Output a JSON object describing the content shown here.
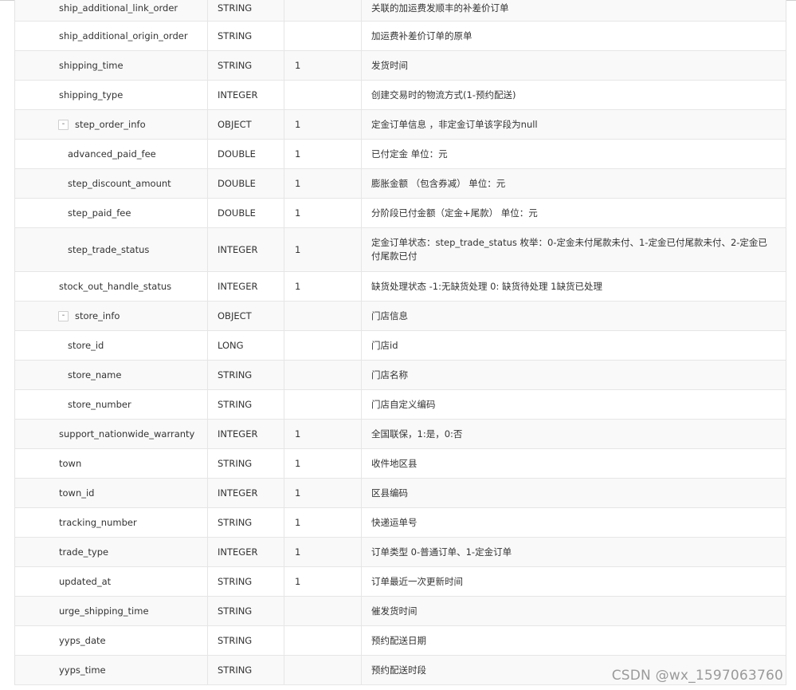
{
  "rows": [
    {
      "name": "ship_additional_link_order",
      "type": "STRING",
      "required": "",
      "desc": "关联的加运费发顺丰的补差价订单"
    },
    {
      "name": "ship_additional_origin_order",
      "type": "STRING",
      "required": "",
      "desc": "加运费补差价订单的原单"
    },
    {
      "name": "shipping_time",
      "type": "STRING",
      "required": "1",
      "desc": "发货时间"
    },
    {
      "name": "shipping_type",
      "type": "INTEGER",
      "required": "",
      "desc": "创建交易时的物流方式(1-预约配送)"
    },
    {
      "name": "step_order_info",
      "type": "OBJECT",
      "required": "1",
      "desc": "定金订单信息 ，非定金订单该字段为null",
      "toggle": "-"
    },
    {
      "name": "advanced_paid_fee",
      "type": "DOUBLE",
      "required": "1",
      "desc": "已付定金 单位：元"
    },
    {
      "name": "step_discount_amount",
      "type": "DOUBLE",
      "required": "1",
      "desc": "膨胀金额 （包含券减） 单位：元"
    },
    {
      "name": "step_paid_fee",
      "type": "DOUBLE",
      "required": "1",
      "desc": "分阶段已付金额（定金+尾款） 单位：元"
    },
    {
      "name": "step_trade_status",
      "type": "INTEGER",
      "required": "1",
      "desc": "定金订单状态：step_trade_status 枚举：0-定金未付尾款未付、1-定金已付尾款未付、2-定金已付尾款已付"
    },
    {
      "name": "stock_out_handle_status",
      "type": "INTEGER",
      "required": "1",
      "desc": "缺货处理状态 -1:无缺货处理 0: 缺货待处理 1缺货已处理"
    },
    {
      "name": "store_info",
      "type": "OBJECT",
      "required": "",
      "desc": "门店信息",
      "toggle": "-"
    },
    {
      "name": "store_id",
      "type": "LONG",
      "required": "",
      "desc": "门店id"
    },
    {
      "name": "store_name",
      "type": "STRING",
      "required": "",
      "desc": "门店名称"
    },
    {
      "name": "store_number",
      "type": "STRING",
      "required": "",
      "desc": "门店自定义编码"
    },
    {
      "name": "support_nationwide_warranty",
      "type": "INTEGER",
      "required": "1",
      "desc": "全国联保，1:是，0:否"
    },
    {
      "name": "town",
      "type": "STRING",
      "required": "1",
      "desc": "收件地区县"
    },
    {
      "name": "town_id",
      "type": "INTEGER",
      "required": "1",
      "desc": "区县编码"
    },
    {
      "name": "tracking_number",
      "type": "STRING",
      "required": "1",
      "desc": "快递运单号"
    },
    {
      "name": "trade_type",
      "type": "INTEGER",
      "required": "1",
      "desc": "订单类型 0-普通订单、1-定金订单"
    },
    {
      "name": "updated_at",
      "type": "STRING",
      "required": "1",
      "desc": "订单最近一次更新时间"
    },
    {
      "name": "urge_shipping_time",
      "type": "STRING",
      "required": "",
      "desc": "催发货时间"
    },
    {
      "name": "yyps_date",
      "type": "STRING",
      "required": "",
      "desc": "预约配送日期"
    },
    {
      "name": "yyps_time",
      "type": "STRING",
      "required": "",
      "desc": "预约配送时段"
    }
  ],
  "watermark": "CSDN @wx_1597063760"
}
